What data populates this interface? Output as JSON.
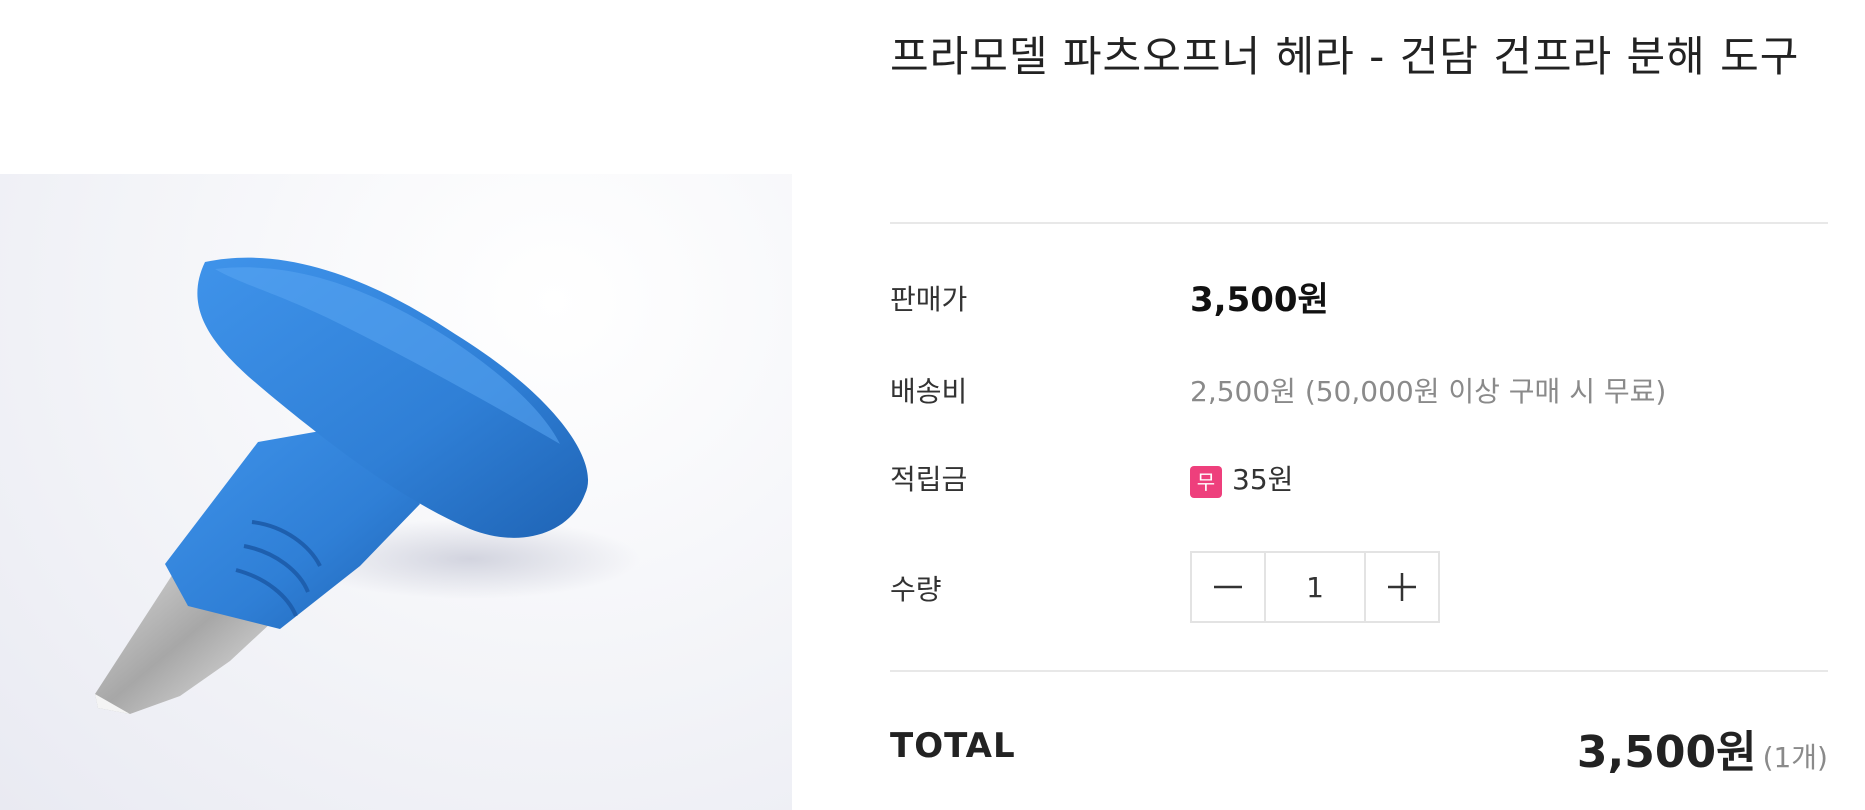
{
  "product": {
    "title": "프라모델 파츠오프너 헤라 - 건담 건프라 분해 도구",
    "image_alt": "blue-handled parts opener tool"
  },
  "details": {
    "price_label": "판매가",
    "price_value": "3,500원",
    "shipping_label": "배송비",
    "shipping_value": "2,500원 (50,000원 이상 구매 시 무료)",
    "points_label": "적립금",
    "points_badge": "무",
    "points_value": "35원",
    "quantity_label": "수량",
    "quantity_value": "1"
  },
  "total": {
    "label": "TOTAL",
    "amount": "3,500원",
    "count": "(1개)"
  },
  "colors": {
    "badge": "#ee3f7c",
    "tool_handle": "#2f7fd6"
  },
  "icons": {
    "decrease": "minus-icon",
    "increase": "plus-icon"
  }
}
